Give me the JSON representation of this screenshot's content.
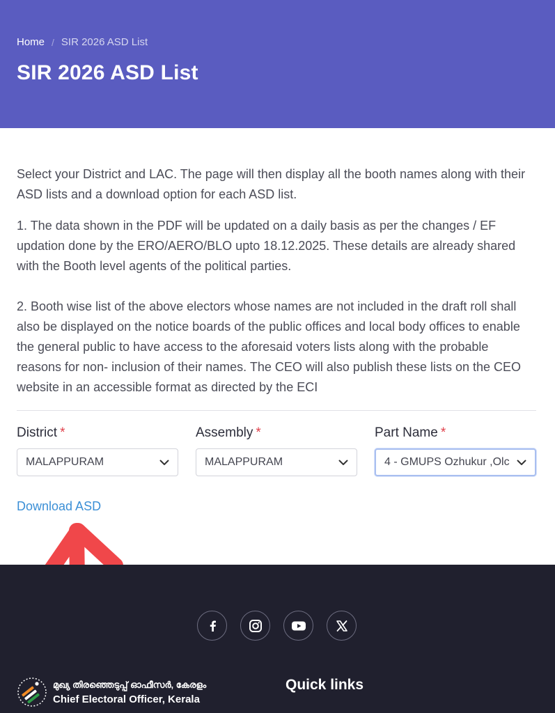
{
  "header": {
    "breadcrumb": {
      "home": "Home",
      "separator": "/",
      "current": "SIR 2026 ASD List"
    },
    "title": "SIR 2026 ASD List"
  },
  "content": {
    "intro": "Select your District and LAC. The page will then display all the booth names along with their ASD lists and a download option for each ASD list.",
    "note1": "1. The data shown in the PDF will be updated on a daily basis as per the changes / EF updation done by the ERO/AERO/BLO upto 18.12.2025. These details are already shared with the Booth level agents of the political parties.",
    "note2": "2. Booth wise list of the above electors whose names are not included in the draft roll shall also be displayed on the notice boards of the public offices and local body offices to enable the general public to have access to the aforesaid voters lists along with the probable reasons for non- inclusion of their names. The CEO will also publish these lists on the CEO website in an accessible format as directed by the ECI"
  },
  "filters": {
    "required_mark": "*",
    "district": {
      "label": "District",
      "value": "MALAPPURAM"
    },
    "assembly": {
      "label": "Assembly",
      "value": "MALAPPURAM"
    },
    "part_name": {
      "label": "Part Name",
      "value": "4 - GMUPS Ozhukur ,Olc"
    }
  },
  "download_link": "Download ASD",
  "footer": {
    "social_icons": [
      "facebook-icon",
      "instagram-icon",
      "youtube-icon",
      "x-icon"
    ],
    "brand_malayalam": "മുഖ്യ തിരഞ്ഞെടുപ്പ് ഓഫീസർ, കേരളം",
    "brand_english": "Chief Electoral Officer, Kerala",
    "quick_links": "Quick links"
  },
  "colors": {
    "header_bg": "#5a5cc0",
    "footer_bg": "#20202e",
    "link": "#3b8fd6",
    "required": "#e0414b",
    "annotation_arrow": "#f0474a"
  }
}
